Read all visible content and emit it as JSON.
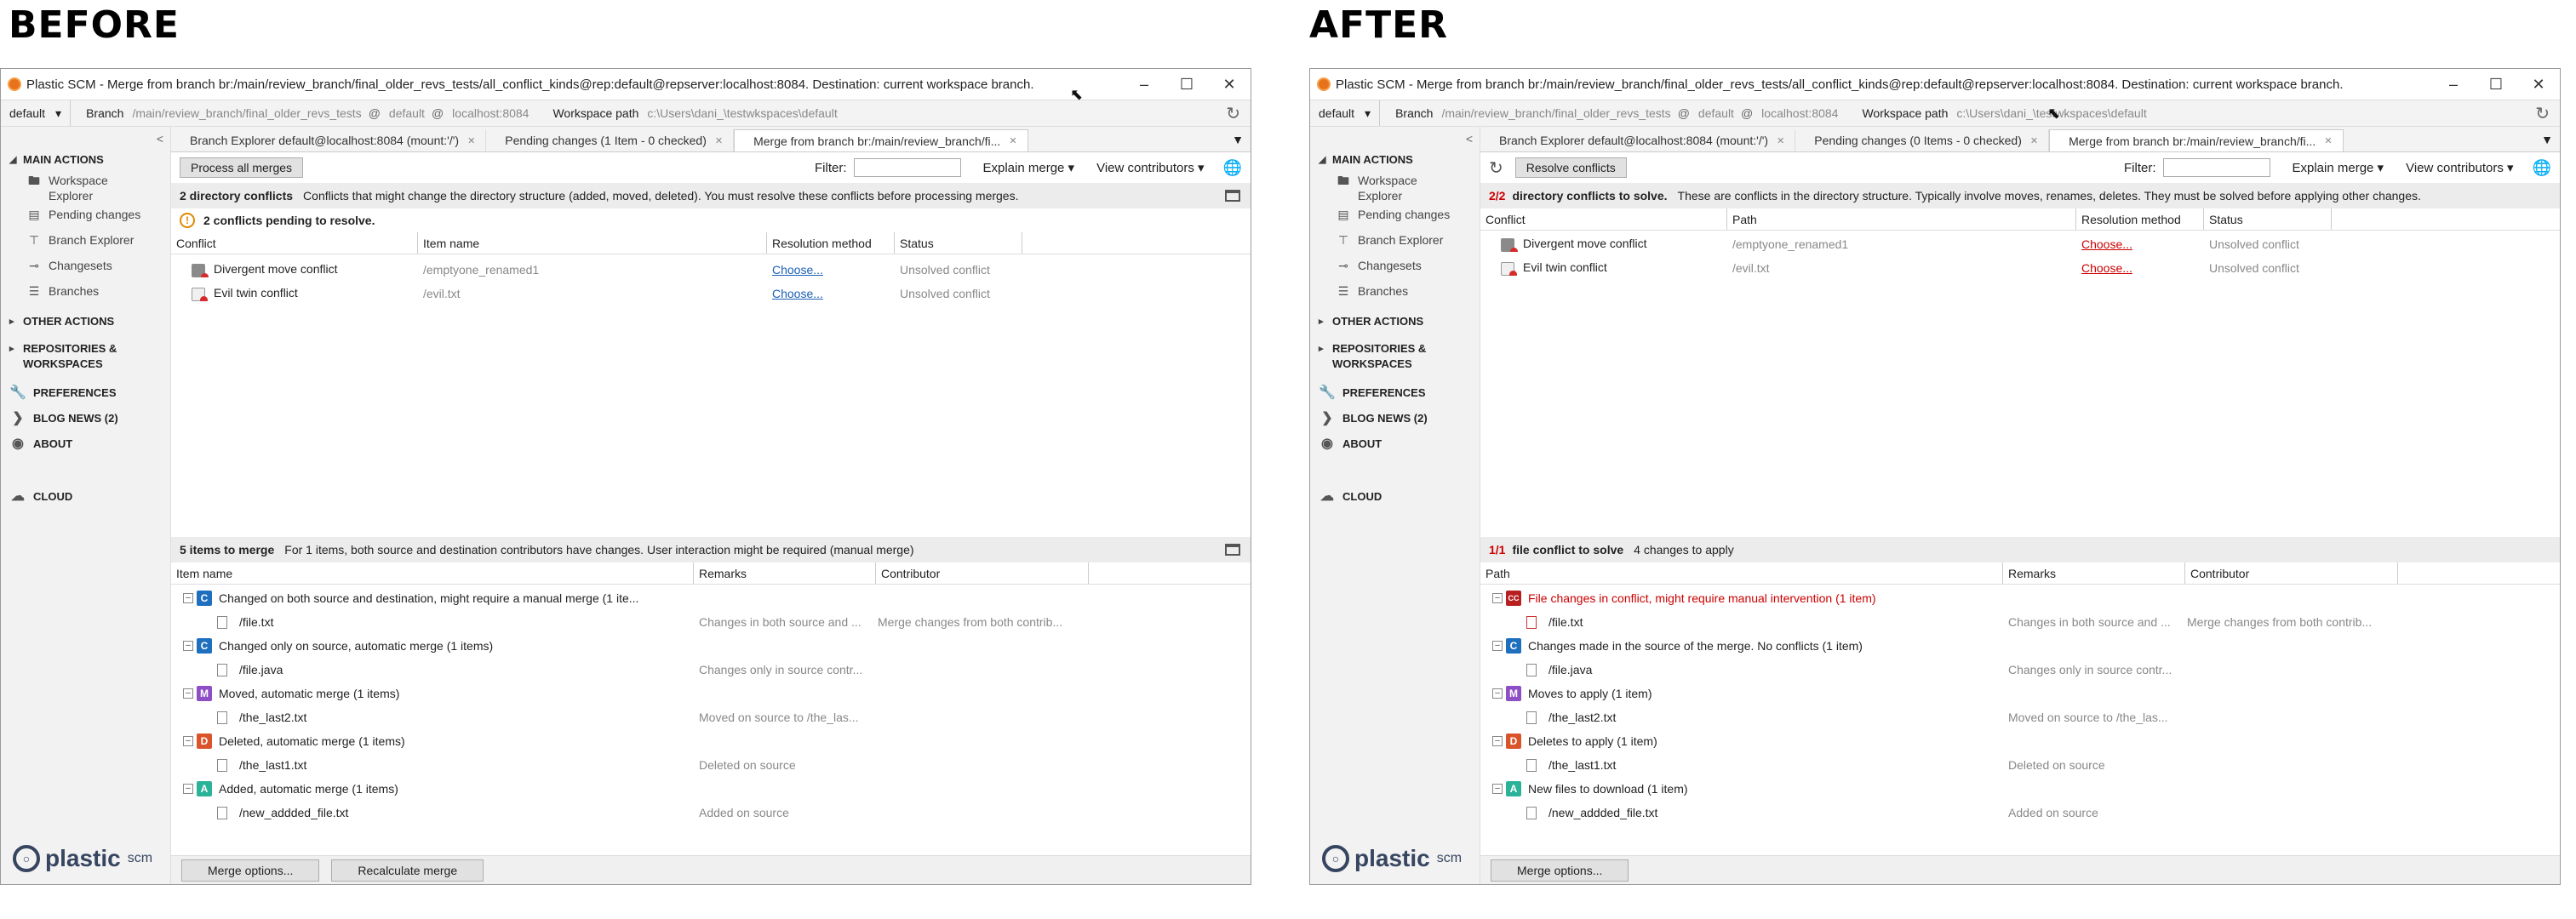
{
  "captions": {
    "before": "BEFORE",
    "after": "AFTER"
  },
  "common": {
    "workspace": "default",
    "branch_label": "Branch",
    "branch_path": "/main/review_branch/final_older_revs_tests",
    "branch_at": "@",
    "branch_repo": "default",
    "branch_server": "localhost:8084",
    "wspath_label": "Workspace path",
    "wspath": "c:\\Users\\dani_\\testwkspaces\\default",
    "sidebar": {
      "main_actions": "MAIN ACTIONS",
      "workspace_explorer": "Workspace Explorer",
      "pending_changes": "Pending changes",
      "branch_explorer": "Branch Explorer",
      "changesets": "Changesets",
      "branches": "Branches",
      "other_actions": "OTHER ACTIONS",
      "repos_workspaces": "REPOSITORIES & WORKSPACES",
      "preferences": "PREFERENCES",
      "blog_news": "BLOG NEWS (2)",
      "about": "ABOUT",
      "cloud": "CLOUD"
    },
    "logo": {
      "name": "plastic",
      "suffix": "scm"
    },
    "filter_label": "Filter:",
    "explain_merge": "Explain merge",
    "view_contributors": "View contributors",
    "merge_options": "Merge options..."
  },
  "before": {
    "title": "Plastic SCM - Merge from branch br:/main/review_branch/final_older_revs_tests/all_conflict_kinds@rep:default@repserver:localhost:8084. Destination: current workspace branch.",
    "tabs": [
      {
        "label": "Branch Explorer default@localhost:8084 (mount:'/')"
      },
      {
        "label": "Pending changes (1 Item - 0 checked)"
      },
      {
        "label": "Merge from branch br:/main/review_branch/fi..."
      }
    ],
    "process_button": "Process all merges",
    "dir_conflicts": {
      "heading": "2 directory conflicts",
      "description": "Conflicts that might change the directory structure (added, moved, deleted). You must resolve these conflicts before processing merges.",
      "pending": "2 conflicts pending to resolve.",
      "columns": [
        "Conflict",
        "Item name",
        "Resolution method",
        "Status"
      ],
      "rows": [
        {
          "conflict": "Divergent move conflict",
          "item": "/emptyone_renamed1",
          "method": "Choose...",
          "status": "Unsolved conflict"
        },
        {
          "conflict": "Evil twin conflict",
          "item": "/evil.txt",
          "method": "Choose...",
          "status": "Unsolved conflict"
        }
      ]
    },
    "items": {
      "heading": "5 items to merge",
      "description": "For 1 items, both source and destination contributors have changes. User interaction might be required (manual merge)",
      "columns": [
        "Item name",
        "Remarks",
        "Contributor"
      ],
      "groups": [
        {
          "badge": "C",
          "label": "Changed on both source and destination, might require a manual merge (1 ite...",
          "file": "/file.txt",
          "remarks": "Changes in both source and ...",
          "contributor": "Merge changes from both contrib..."
        },
        {
          "badge": "C",
          "label": "Changed only on source, automatic merge (1 items)",
          "file": "/file.java",
          "remarks": "Changes only in source contr...",
          "contributor": ""
        },
        {
          "badge": "M",
          "label": "Moved, automatic merge (1 items)",
          "file": "/the_last2.txt",
          "remarks": "Moved on source to /the_las...",
          "contributor": ""
        },
        {
          "badge": "D",
          "label": "Deleted, automatic merge (1 items)",
          "file": "/the_last1.txt",
          "remarks": "Deleted on source",
          "contributor": ""
        },
        {
          "badge": "A",
          "label": "Added, automatic merge (1 items)",
          "file": "/new_addded_file.txt",
          "remarks": "Added on source",
          "contributor": ""
        }
      ]
    },
    "recalculate": "Recalculate merge"
  },
  "after": {
    "title": "Plastic SCM - Merge from branch br:/main/review_branch/final_older_revs_tests/all_conflict_kinds@rep:default@repserver:localhost:8084. Destination: current workspace branch.",
    "tabs": [
      {
        "label": "Branch Explorer default@localhost:8084 (mount:'/')"
      },
      {
        "label": "Pending changes (0 Items - 0 checked)"
      },
      {
        "label": "Merge from branch br:/main/review_branch/fi..."
      }
    ],
    "resolve_button": "Resolve conflicts",
    "dir_conflicts": {
      "count": "2/2",
      "heading": "directory conflicts to solve.",
      "description": "These are conflicts in the directory structure. Typically involve moves, renames, deletes. They must be solved before applying other changes.",
      "columns": [
        "Conflict",
        "Path",
        "Resolution method",
        "Status"
      ],
      "rows": [
        {
          "conflict": "Divergent move conflict",
          "item": "/emptyone_renamed1",
          "method": "Choose...",
          "status": "Unsolved conflict"
        },
        {
          "conflict": "Evil twin conflict",
          "item": "/evil.txt",
          "method": "Choose...",
          "status": "Unsolved conflict"
        }
      ]
    },
    "items": {
      "count": "1/1",
      "heading": "file conflict to solve",
      "changes": "4 changes to apply",
      "columns": [
        "Path",
        "Remarks",
        "Contributor"
      ],
      "groups": [
        {
          "badge": "CC",
          "label": "File changes in conflict, might require manual intervention (1 item)",
          "file": "/file.txt",
          "remarks": "Changes in both source and ...",
          "contributor": "Merge changes from both contrib..."
        },
        {
          "badge": "C",
          "label": "Changes made in the source of the merge. No conflicts (1 item)",
          "file": "/file.java",
          "remarks": "Changes only in source contr...",
          "contributor": ""
        },
        {
          "badge": "M",
          "label": "Moves to apply (1 item)",
          "file": "/the_last2.txt",
          "remarks": "Moved on source to /the_las...",
          "contributor": ""
        },
        {
          "badge": "D",
          "label": "Deletes to apply (1 item)",
          "file": "/the_last1.txt",
          "remarks": "Deleted on source",
          "contributor": ""
        },
        {
          "badge": "A",
          "label": "New files to download (1 item)",
          "file": "/new_addded_file.txt",
          "remarks": "Added on source",
          "contributor": ""
        }
      ]
    }
  }
}
